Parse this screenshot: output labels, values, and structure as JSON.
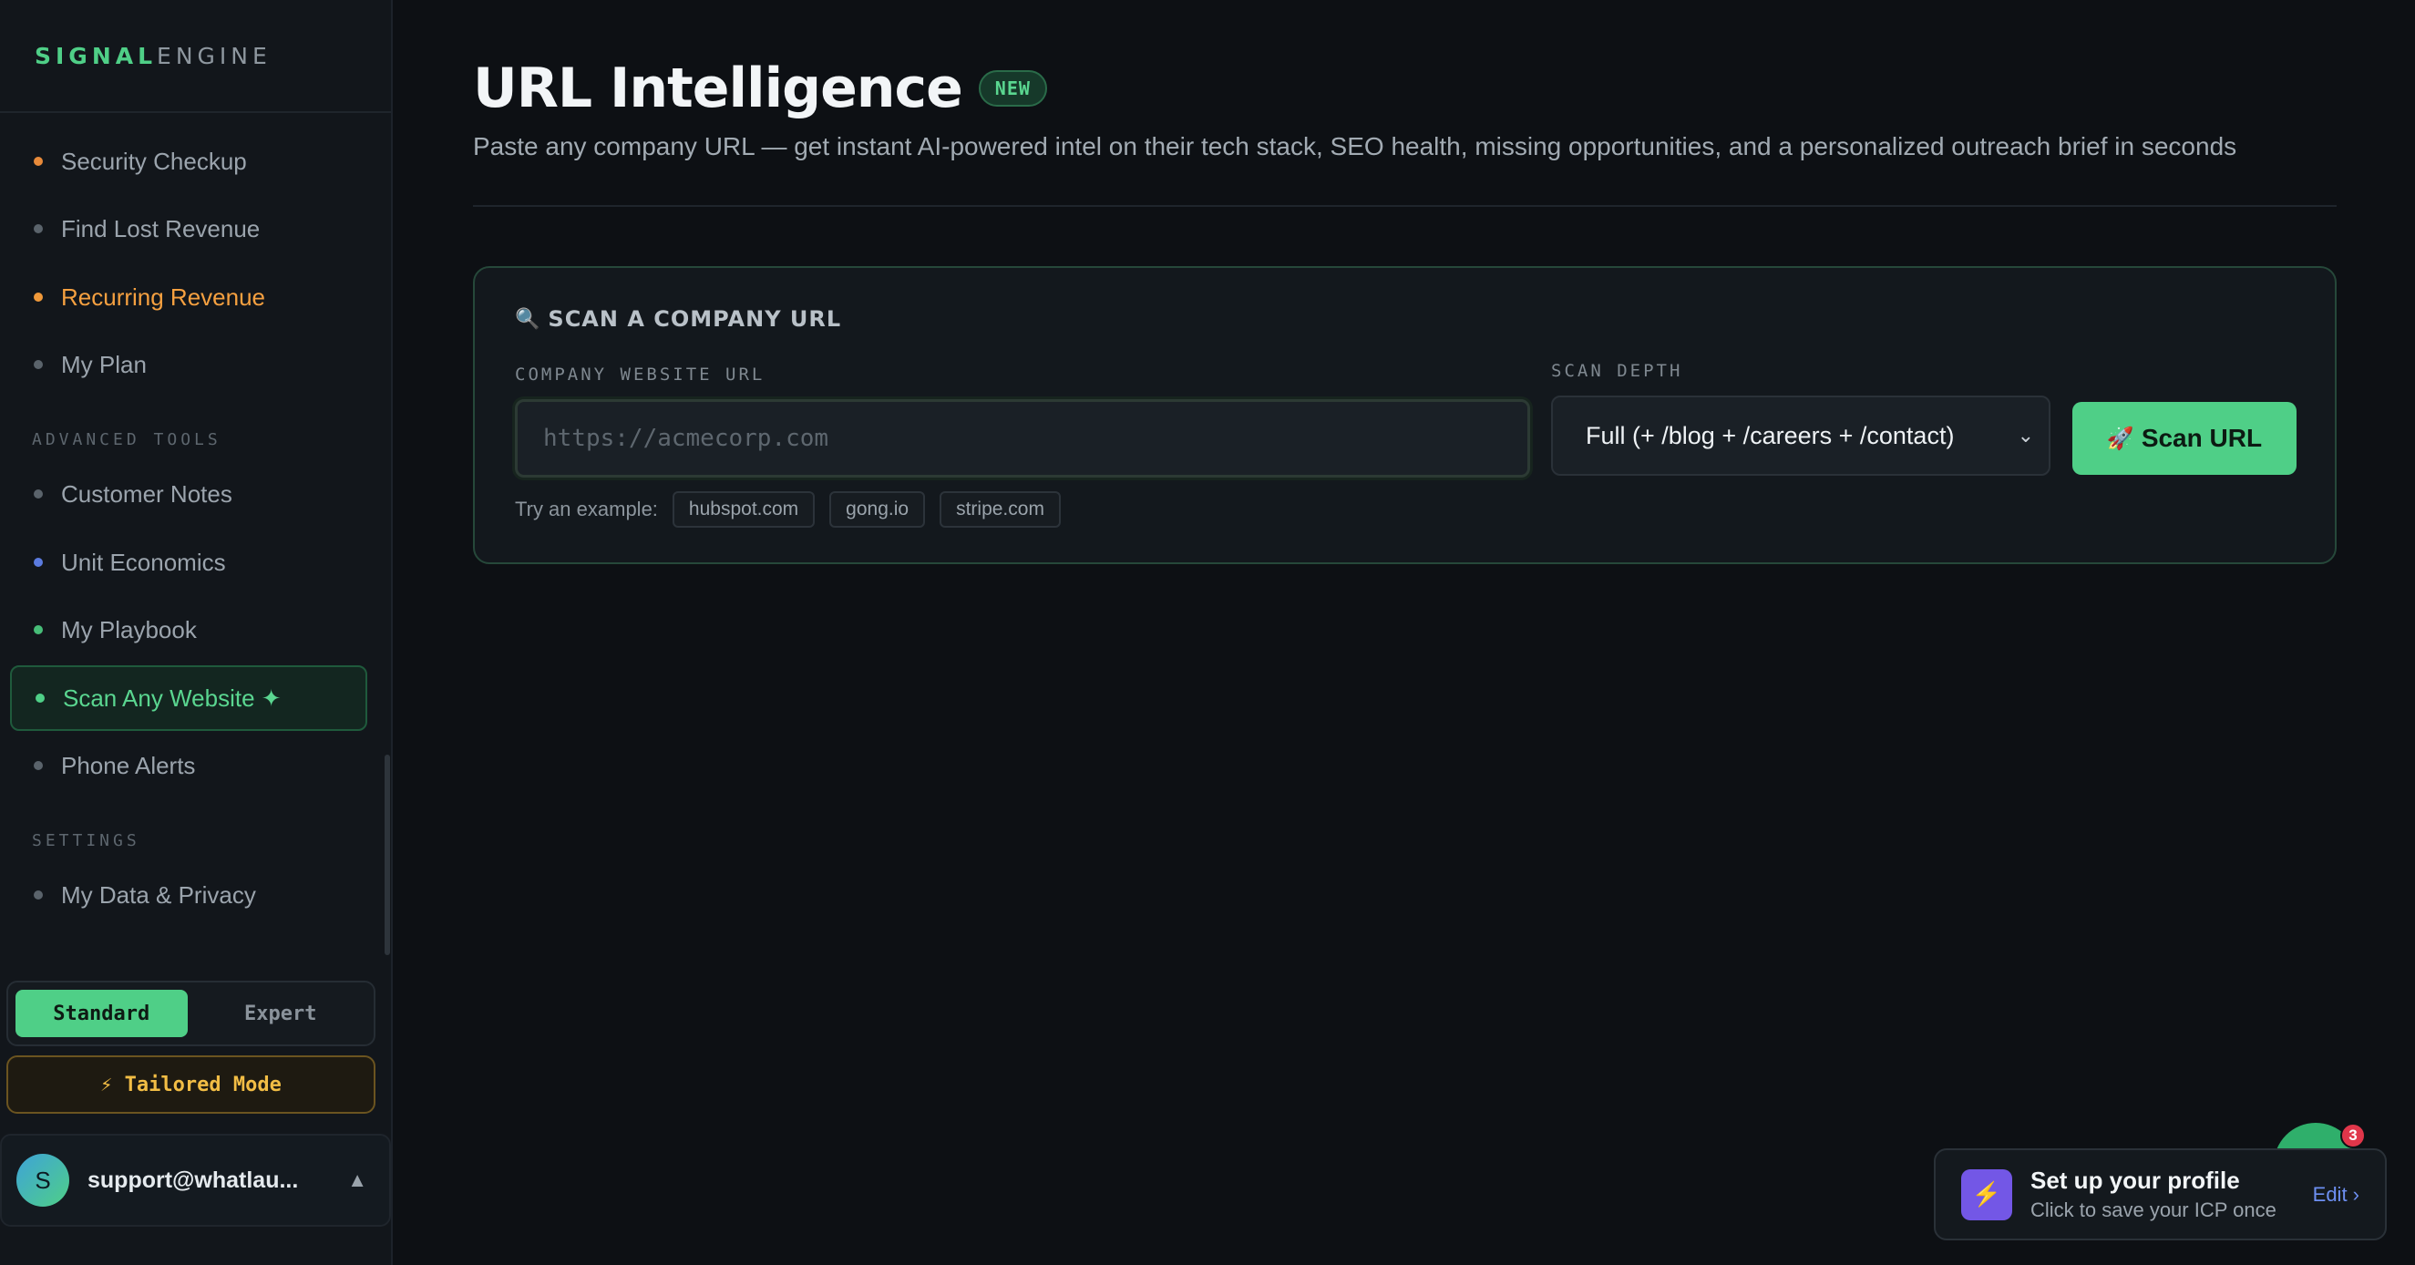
{
  "brand": {
    "part1": "SIGNAL",
    "part2": "ENGINE"
  },
  "sidebar": {
    "items": [
      {
        "label": "Security Checkup"
      },
      {
        "label": "Find Lost Revenue"
      },
      {
        "label": "Recurring Revenue"
      },
      {
        "label": "My Plan"
      },
      {
        "label": "Customer Notes"
      },
      {
        "label": "Unit Economics"
      },
      {
        "label": "My Playbook"
      },
      {
        "label": "Scan Any Website ✦"
      },
      {
        "label": "Phone Alerts"
      },
      {
        "label": "My Data & Privacy"
      }
    ],
    "sections": {
      "advanced": "ADVANCED TOOLS",
      "settings": "SETTINGS"
    },
    "mode": {
      "standard": "Standard",
      "expert": "Expert",
      "selected": "Standard"
    },
    "tailored": "⚡ Tailored Mode",
    "user": {
      "initial": "S",
      "email": "support@whatlau..."
    }
  },
  "main": {
    "title": "URL Intelligence",
    "badge": "NEW",
    "subtitle": "Paste any company URL — get instant AI-powered intel on their tech stack, SEO health, missing opportunities, and a personalized outreach brief in seconds",
    "card": {
      "heading": "SCAN A COMPANY URL",
      "url_label": "COMPANY WEBSITE URL",
      "url_placeholder": "https://acmecorp.com",
      "url_value": "",
      "depth_label": "SCAN DEPTH",
      "depth_value": "Full (+ /blog + /careers + /contact)",
      "scan_button": "Scan URL",
      "try_label": "Try an example:",
      "examples": [
        "hubspot.com",
        "gong.io",
        "stripe.com"
      ]
    }
  },
  "toast": {
    "title": "Set up your profile",
    "subtitle": "Click to save your ICP once",
    "edit": "Edit ›",
    "badge_count": "3"
  },
  "colors": {
    "accent": "#4fcf87",
    "warning": "#f2bd45",
    "orange": "#f5a040"
  },
  "icons": {
    "card_heading": "magnifier-icon",
    "scan_button": "rocket-icon",
    "toast": "lightning-icon",
    "user_caret": "caret-up-icon",
    "select_chevron": "chevron-down-icon"
  }
}
